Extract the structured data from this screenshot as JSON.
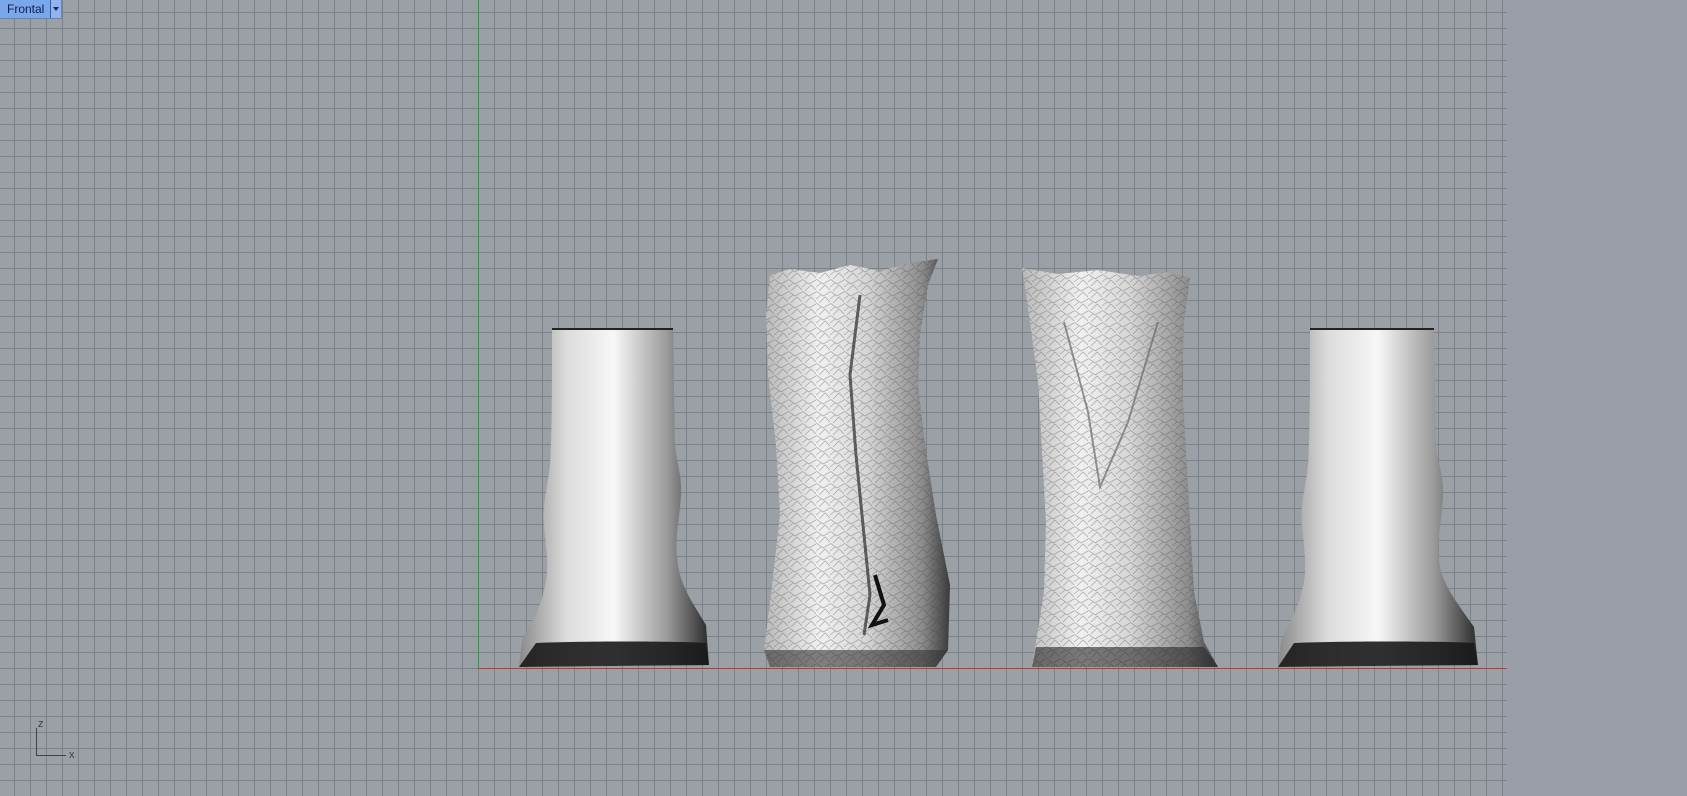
{
  "viewport": {
    "name": "Frontal"
  },
  "axes_gizmo": {
    "z_label": "z",
    "x_label": "x",
    "y_axis_color": "#1ea33a",
    "x_axis_color": "#c0392b"
  },
  "objects": [
    {
      "kind": "smooth-vase"
    },
    {
      "kind": "rough-scan-vase"
    },
    {
      "kind": "rough-scan-vase"
    },
    {
      "kind": "smooth-vase"
    }
  ]
}
